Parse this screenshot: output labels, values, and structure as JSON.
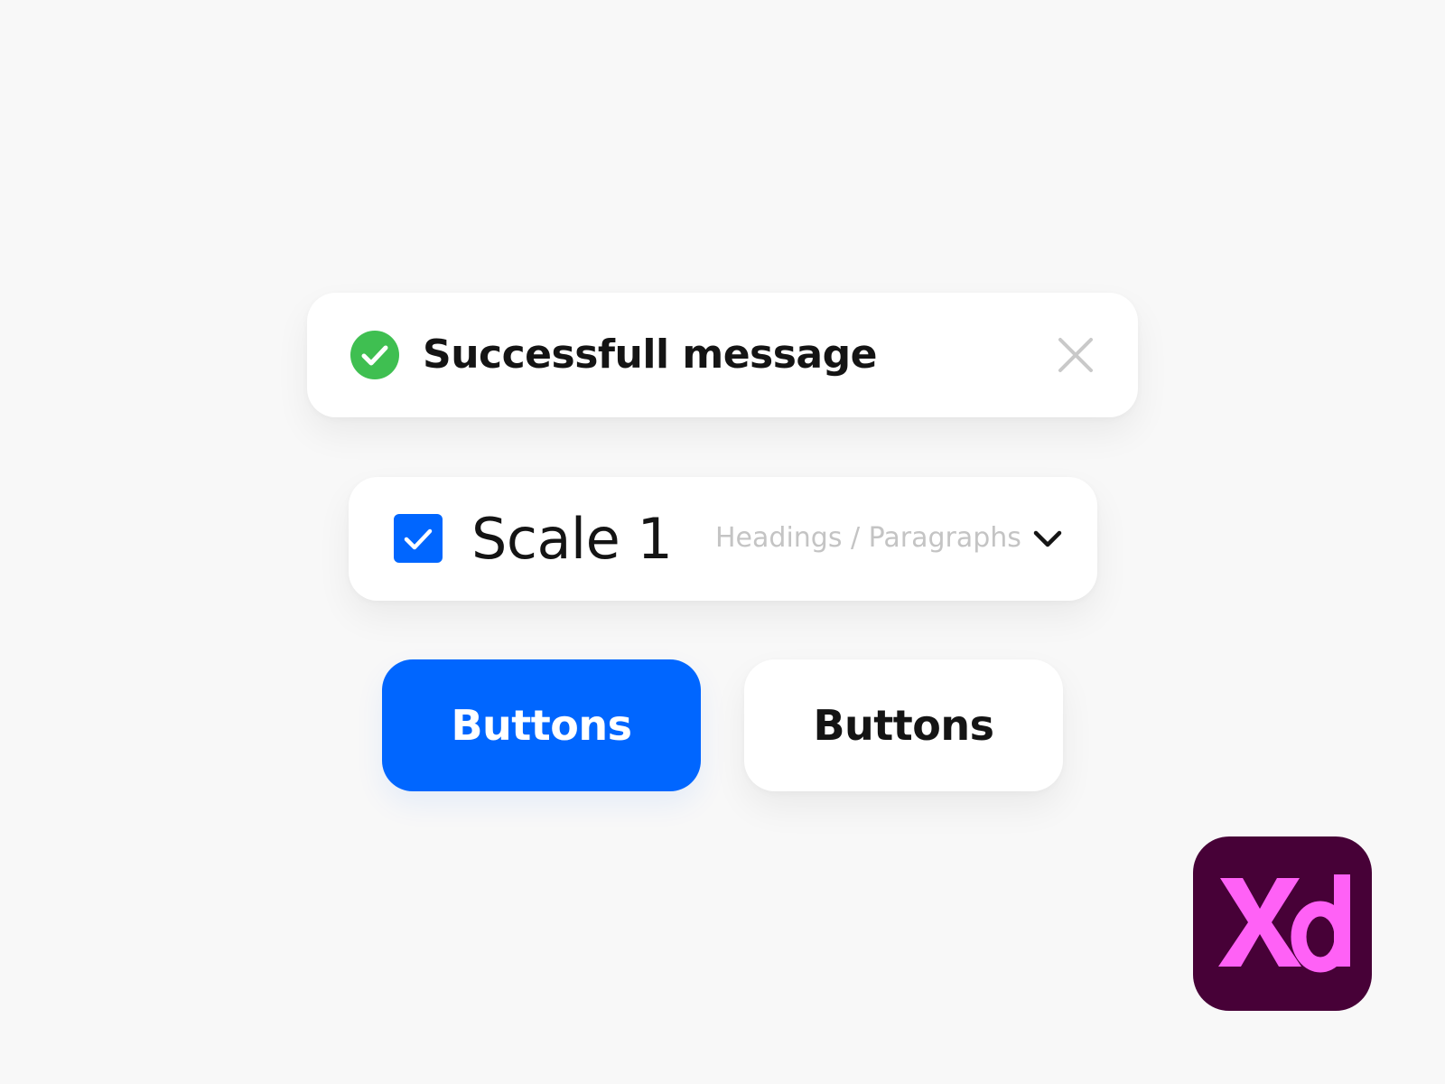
{
  "colors": {
    "page_background": "#f8f8f8",
    "success_green": "#3fbf51",
    "accent_blue": "#0066ff",
    "text_dark": "#141414",
    "muted_text": "#c4c4c4",
    "close_icon_gray": "#c9c9c9",
    "xd_logo_background": "#470137",
    "xd_logo_letters": "#ff61f6"
  },
  "toast": {
    "icon": "check-circle-icon",
    "message": "Successfull message",
    "close_icon": "close-icon"
  },
  "scale_row": {
    "checkbox_checked": true,
    "checkbox_icon": "checkmark-icon",
    "label": "Scale 1",
    "dropdown": {
      "selected": "Headings / Paragraphs",
      "icon": "chevron-down-icon"
    }
  },
  "buttons": {
    "primary_label": "Buttons",
    "secondary_label": "Buttons"
  },
  "logo": {
    "icon": "adobe-xd-logo",
    "text": "Xd"
  }
}
